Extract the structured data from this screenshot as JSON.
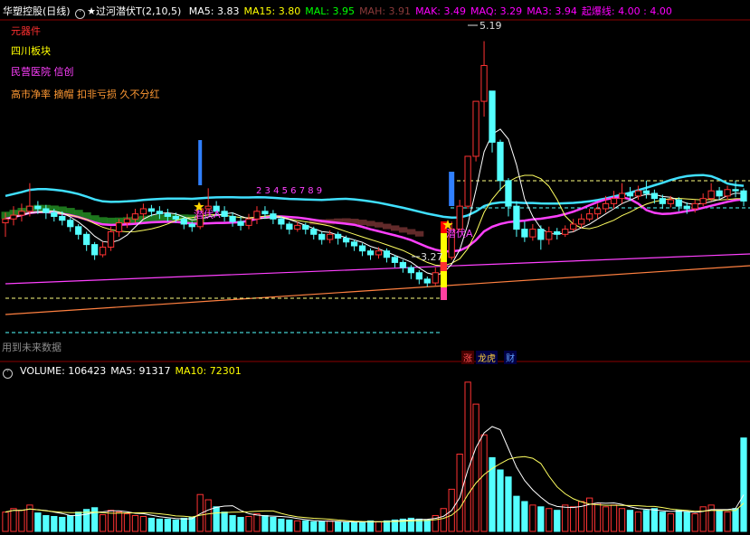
{
  "header": {
    "stock_name": "华塑控股",
    "period": "(日线)",
    "indicator_name": "★过河潜伏T(2,10,5)",
    "items": [
      {
        "label": "MA5:",
        "value": "3.83",
        "color": "#ffffff"
      },
      {
        "label": "MA15:",
        "value": "3.80",
        "color": "#ffff00"
      },
      {
        "label": "MAL:",
        "value": "3.95",
        "color": "#00ff00"
      },
      {
        "label": "MAH:",
        "value": "3.91",
        "color": "#8b3a3a"
      },
      {
        "label": "MAK:",
        "value": "3.49",
        "color": "#ff00ff"
      },
      {
        "label": "MAQ:",
        "value": "3.29",
        "color": "#ff00ff"
      },
      {
        "label": "MA3:",
        "value": "3.94",
        "color": "#ff00ff"
      },
      {
        "label": "起爆线:",
        "value": "4.00 : 4.00",
        "color": "#ff00ff"
      }
    ]
  },
  "concepts": [
    {
      "text": "元器件",
      "color": "#ff3030"
    },
    {
      "text": "四川板块",
      "color": "#ffff00"
    },
    {
      "text": "民营医院 信创",
      "color": "#ff40ff"
    },
    {
      "text": "高市净率 摘帽 扣非亏损 久不分红",
      "color": "#ff9933"
    }
  ],
  "labels": {
    "future_data": "用到未来数据",
    "high_price": "5.19",
    "low_price": "3.27",
    "mark_a1": "潜伏A",
    "mark_a2": "潜伏A",
    "mid_marks": "2 3 4 5 6 7 8 9",
    "badge_zhang": "涨",
    "badge_long": "龙虎",
    "badge_cai": "财"
  },
  "volume_header": {
    "items": [
      {
        "label": "VOLUME:",
        "value": "106423",
        "color": "#ffffff"
      },
      {
        "label": "MA5:",
        "value": "91317",
        "color": "#ffffff"
      },
      {
        "label": "MA10:",
        "value": "72301",
        "color": "#ffff00"
      }
    ]
  },
  "colors": {
    "up": "#ff3333",
    "down": "#54ffff",
    "ma_cyan": "#40e0ff",
    "ma_magenta": "#ff40ff",
    "ma_yellow": "#ffff60",
    "ma_white": "#ffffff",
    "band_green": "#228b22",
    "band_brown": "#6b2f2f",
    "trend_orange": "#ff8040"
  },
  "chart_data": {
    "type": "candlestick",
    "ylim": [
      2.7,
      5.3
    ],
    "volume_ylim": [
      0,
      175000
    ],
    "candles": [
      [
        3.77,
        3.8,
        3.85,
        3.66
      ],
      [
        3.8,
        3.83,
        3.9,
        3.75
      ],
      [
        3.83,
        3.86,
        3.92,
        3.78
      ],
      [
        3.86,
        3.9,
        4.08,
        3.82
      ],
      [
        3.9,
        3.88,
        3.94,
        3.84
      ],
      [
        3.88,
        3.85,
        3.91,
        3.8
      ],
      [
        3.85,
        3.82,
        3.88,
        3.78
      ],
      [
        3.82,
        3.79,
        3.86,
        3.75
      ],
      [
        3.79,
        3.74,
        3.81,
        3.7
      ],
      [
        3.74,
        3.68,
        3.76,
        3.64
      ],
      [
        3.68,
        3.6,
        3.7,
        3.55
      ],
      [
        3.6,
        3.52,
        3.62,
        3.48
      ],
      [
        3.52,
        3.58,
        3.62,
        3.5
      ],
      [
        3.58,
        3.7,
        3.74,
        3.55
      ],
      [
        3.7,
        3.77,
        3.8,
        3.66
      ],
      [
        3.77,
        3.8,
        3.84,
        3.73
      ],
      [
        3.8,
        3.84,
        3.88,
        3.77
      ],
      [
        3.84,
        3.88,
        3.92,
        3.8
      ],
      [
        3.88,
        3.86,
        3.91,
        3.82
      ],
      [
        3.86,
        3.84,
        3.9,
        3.8
      ],
      [
        3.84,
        3.82,
        3.88,
        3.78
      ],
      [
        3.82,
        3.8,
        3.85,
        3.77
      ],
      [
        3.8,
        3.76,
        3.82,
        3.72
      ],
      [
        3.76,
        3.74,
        3.78,
        3.7
      ],
      [
        3.74,
        3.88,
        3.92,
        3.72
      ],
      [
        3.88,
        3.9,
        4.04,
        3.84
      ],
      [
        3.9,
        3.86,
        3.94,
        3.82
      ],
      [
        3.86,
        3.82,
        3.9,
        3.78
      ],
      [
        3.82,
        3.78,
        3.85,
        3.74
      ],
      [
        3.78,
        3.75,
        3.82,
        3.71
      ],
      [
        3.75,
        3.8,
        3.84,
        3.72
      ],
      [
        3.8,
        3.86,
        3.9,
        3.76
      ],
      [
        3.86,
        3.84,
        3.9,
        3.8
      ],
      [
        3.84,
        3.8,
        3.87,
        3.76
      ],
      [
        3.8,
        3.76,
        3.82,
        3.72
      ],
      [
        3.76,
        3.72,
        3.78,
        3.68
      ],
      [
        3.72,
        3.75,
        3.78,
        3.7
      ],
      [
        3.75,
        3.72,
        3.77,
        3.68
      ],
      [
        3.72,
        3.68,
        3.74,
        3.64
      ],
      [
        3.68,
        3.64,
        3.7,
        3.6
      ],
      [
        3.64,
        3.68,
        3.71,
        3.61
      ],
      [
        3.68,
        3.65,
        3.7,
        3.6
      ],
      [
        3.65,
        3.62,
        3.67,
        3.58
      ],
      [
        3.62,
        3.59,
        3.64,
        3.55
      ],
      [
        3.59,
        3.55,
        3.61,
        3.51
      ],
      [
        3.55,
        3.52,
        3.57,
        3.48
      ],
      [
        3.52,
        3.55,
        3.58,
        3.49
      ],
      [
        3.55,
        3.5,
        3.57,
        3.46
      ],
      [
        3.5,
        3.46,
        3.52,
        3.42
      ],
      [
        3.46,
        3.42,
        3.48,
        3.38
      ],
      [
        3.42,
        3.38,
        3.44,
        3.33
      ],
      [
        3.38,
        3.33,
        3.4,
        3.29
      ],
      [
        3.33,
        3.3,
        3.35,
        3.27
      ],
      [
        3.3,
        3.38,
        3.42,
        3.28
      ],
      [
        3.38,
        3.5,
        3.56,
        3.36
      ],
      [
        3.5,
        3.72,
        3.78,
        3.48
      ],
      [
        3.72,
        3.9,
        3.95,
        3.7
      ],
      [
        3.9,
        4.29,
        4.29,
        3.88
      ],
      [
        4.29,
        4.72,
        4.72,
        4.25
      ],
      [
        4.72,
        5.0,
        5.19,
        4.6
      ],
      [
        4.8,
        4.4,
        4.7,
        4.32
      ],
      [
        4.4,
        4.1,
        4.42,
        4.02
      ],
      [
        4.1,
        3.9,
        4.12,
        3.82
      ],
      [
        3.9,
        3.72,
        3.94,
        3.66
      ],
      [
        3.72,
        3.66,
        3.78,
        3.62
      ],
      [
        3.66,
        3.72,
        3.76,
        3.63
      ],
      [
        3.72,
        3.64,
        3.75,
        3.56
      ],
      [
        3.64,
        3.7,
        3.74,
        3.6
      ],
      [
        3.7,
        3.68,
        3.73,
        3.64
      ],
      [
        3.68,
        3.72,
        3.75,
        3.66
      ],
      [
        3.72,
        3.76,
        3.8,
        3.7
      ],
      [
        3.76,
        3.8,
        3.84,
        3.73
      ],
      [
        3.8,
        3.84,
        3.88,
        3.78
      ],
      [
        3.84,
        3.88,
        3.92,
        3.8
      ],
      [
        3.88,
        3.92,
        3.98,
        3.85
      ],
      [
        3.92,
        3.96,
        4.02,
        3.88
      ],
      [
        3.96,
        4.0,
        4.08,
        3.92
      ],
      [
        4.0,
        3.98,
        4.05,
        3.94
      ],
      [
        3.98,
        4.02,
        4.06,
        3.95
      ],
      [
        4.02,
        4.0,
        4.1,
        3.96
      ],
      [
        4.0,
        3.96,
        4.03,
        3.92
      ],
      [
        3.96,
        3.92,
        3.99,
        3.88
      ],
      [
        3.92,
        3.95,
        3.98,
        3.89
      ],
      [
        3.95,
        3.9,
        3.97,
        3.86
      ],
      [
        3.9,
        3.88,
        3.93,
        3.84
      ],
      [
        3.88,
        3.92,
        3.95,
        3.85
      ],
      [
        3.92,
        3.96,
        4.0,
        3.9
      ],
      [
        3.96,
        4.02,
        4.08,
        3.94
      ],
      [
        4.02,
        3.98,
        4.05,
        3.95
      ],
      [
        3.98,
        4.03,
        4.06,
        3.95
      ],
      [
        4.03,
        4.02,
        4.1,
        3.97
      ],
      [
        4.02,
        3.94,
        4.04,
        3.9
      ]
    ],
    "volume": [
      22000,
      26000,
      24000,
      30000,
      21000,
      18000,
      17000,
      16000,
      18000,
      22000,
      25000,
      27000,
      19000,
      24000,
      22000,
      20000,
      18000,
      17000,
      15000,
      14000,
      14000,
      13000,
      15000,
      16000,
      42000,
      36000,
      28000,
      22000,
      18000,
      16000,
      17000,
      20000,
      18000,
      16000,
      14000,
      13000,
      12000,
      12000,
      11000,
      11000,
      12000,
      11000,
      10000,
      10000,
      11000,
      12000,
      11000,
      12000,
      13000,
      14000,
      15000,
      14000,
      13000,
      18000,
      26000,
      48000,
      88000,
      170000,
      145000,
      110000,
      84000,
      70000,
      62000,
      40000,
      34000,
      30000,
      28000,
      26000,
      24000,
      30000,
      28000,
      34000,
      38000,
      32000,
      28000,
      30000,
      26000,
      24000,
      22000,
      24000,
      26000,
      22000,
      20000,
      24000,
      22000,
      20000,
      28000,
      30000,
      24000,
      22000,
      26000,
      106423
    ]
  }
}
